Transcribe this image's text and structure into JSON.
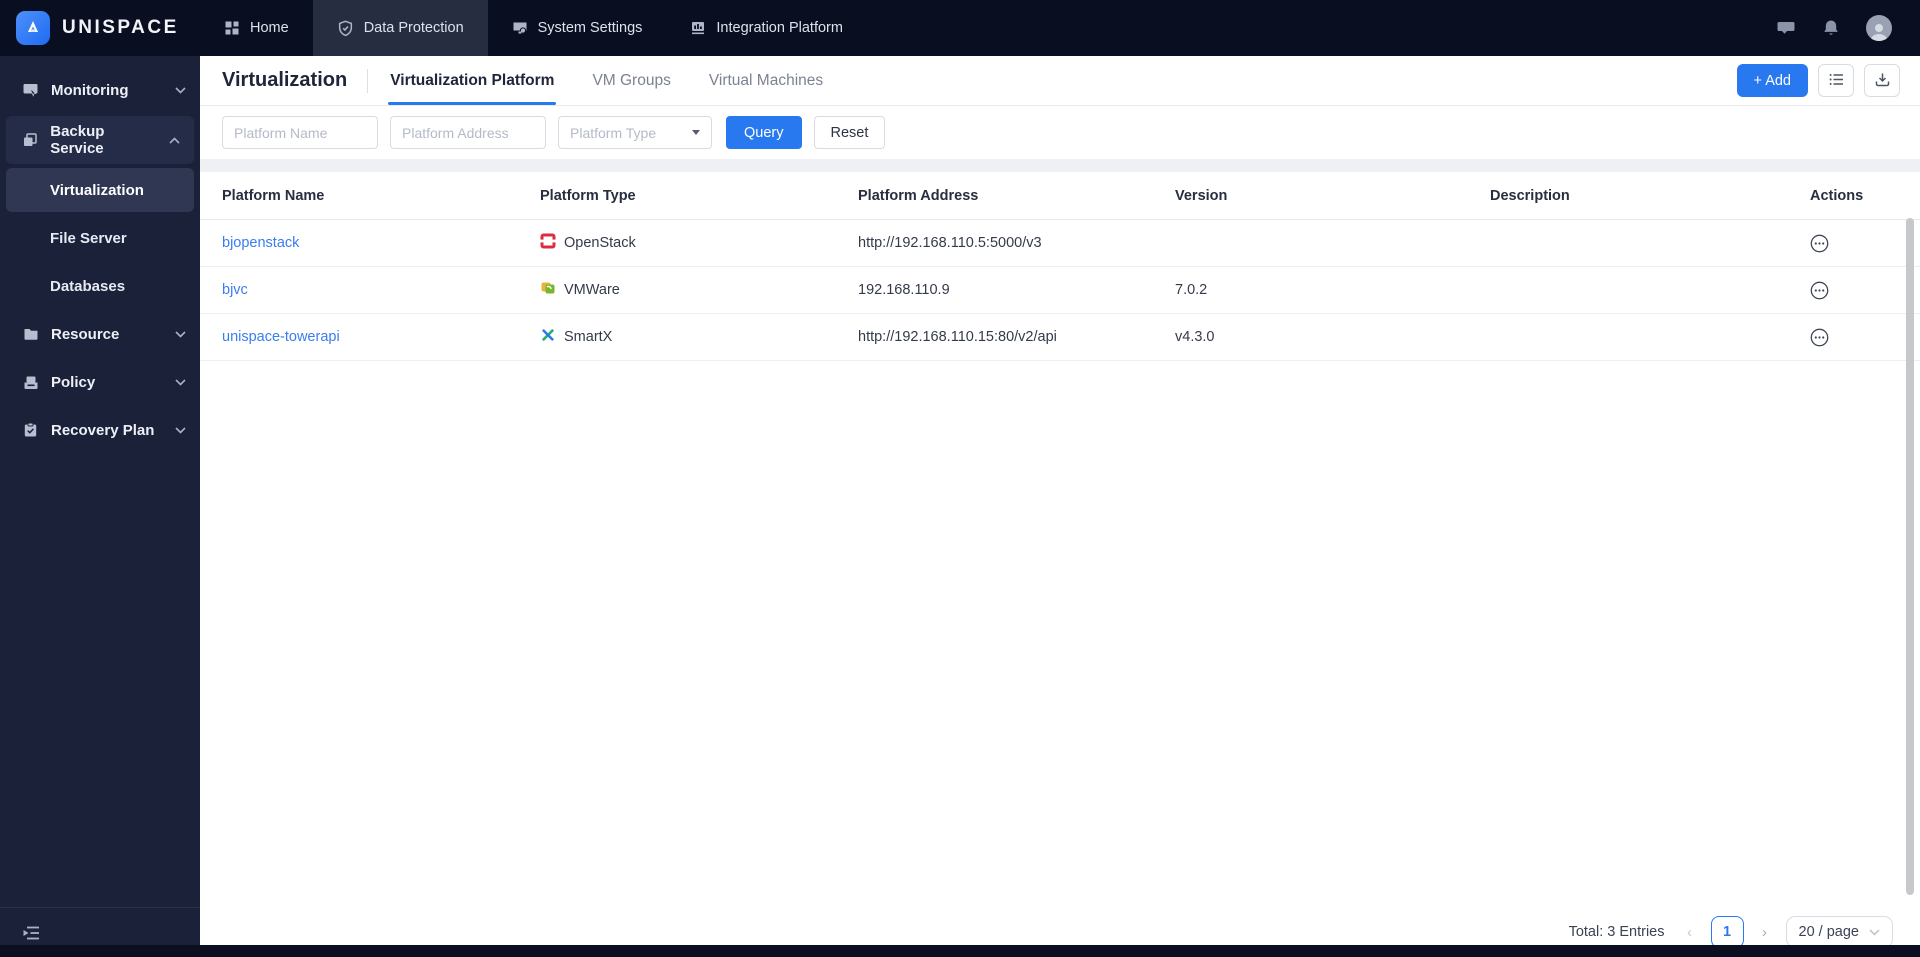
{
  "brand": {
    "name": "UNISPACE",
    "logo_icon": "mountain-logo-icon"
  },
  "topnav": {
    "items": [
      {
        "label": "Home",
        "icon": "dashboard-icon",
        "active": false
      },
      {
        "label": "Data Protection",
        "icon": "shield-check-icon",
        "active": true
      },
      {
        "label": "System Settings",
        "icon": "system-settings-icon",
        "active": false
      },
      {
        "label": "Integration Platform",
        "icon": "integration-chart-icon",
        "active": false
      }
    ],
    "right_icons": [
      "chat-icon",
      "bell-icon",
      "user-avatar"
    ]
  },
  "sidebar": {
    "items": [
      {
        "label": "Monitoring",
        "icon": "monitor-icon",
        "chevron": "down"
      },
      {
        "label": "Backup Service",
        "icon": "backup-copy-icon",
        "chevron": "up",
        "expanded": true
      },
      {
        "label": "Virtualization",
        "child": true,
        "active": true
      },
      {
        "label": "File Server",
        "child": true,
        "active": false
      },
      {
        "label": "Databases",
        "child": true,
        "active": false
      },
      {
        "label": "Resource",
        "icon": "folder-icon",
        "chevron": "down"
      },
      {
        "label": "Policy",
        "icon": "policy-device-icon",
        "chevron": "down"
      },
      {
        "label": "Recovery Plan",
        "icon": "clipboard-check-icon",
        "chevron": "down"
      }
    ],
    "collapse_icon": "collapse-sidebar-icon"
  },
  "page": {
    "title": "Virtualization",
    "tabs": [
      {
        "label": "Virtualization Platform",
        "active": true
      },
      {
        "label": "VM Groups",
        "active": false
      },
      {
        "label": "Virtual Machines",
        "active": false
      }
    ],
    "add_button": "+ Add",
    "toolbar_icons": [
      "list-view-icon",
      "download-icon"
    ]
  },
  "filters": {
    "platform_name_placeholder": "Platform Name",
    "platform_address_placeholder": "Platform Address",
    "platform_type_placeholder": "Platform Type",
    "query_label": "Query",
    "reset_label": "Reset"
  },
  "table": {
    "columns": [
      "Platform Name",
      "Platform Type",
      "Platform Address",
      "Version",
      "Description",
      "Actions"
    ],
    "rows": [
      {
        "name": "bjopenstack",
        "type": "OpenStack",
        "type_icon": "openstack-icon",
        "address": "http://192.168.110.5:5000/v3",
        "version": "",
        "description": ""
      },
      {
        "name": "bjvc",
        "type": "VMWare",
        "type_icon": "vmware-icon",
        "address": "192.168.110.9",
        "version": "7.0.2",
        "description": ""
      },
      {
        "name": "unispace-towerapi",
        "type": "SmartX",
        "type_icon": "smartx-icon",
        "address": "http://192.168.110.15:80/v2/api",
        "version": "v4.3.0",
        "description": ""
      }
    ]
  },
  "pagination": {
    "total_text": "Total: 3 Entries",
    "prev_arrow": "‹",
    "current_page": "1",
    "next_arrow": "›",
    "page_size": "20 / page"
  },
  "colors": {
    "accent": "#2878f0",
    "link": "#3a7df0",
    "navbar_bg": "#0a0e21",
    "sidebar_bg": "#1a2139",
    "openstack_red": "#dd2c3e",
    "vmware_green": "#7ab52d",
    "smartx_blue": "#2878f0",
    "smartx_green": "#27b36b"
  }
}
